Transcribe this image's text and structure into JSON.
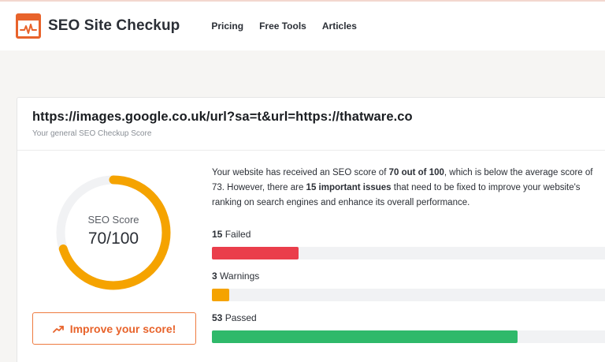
{
  "header": {
    "brand": "SEO Site Checkup",
    "nav": [
      {
        "label": "Pricing"
      },
      {
        "label": "Free Tools"
      },
      {
        "label": "Articles"
      }
    ],
    "logo_icon": "pulse-monitor-icon",
    "accent_color": "#e8632b"
  },
  "report": {
    "url": "https://images.google.co.uk/url?sa=t&url=https://thatware.co",
    "subtitle": "Your general SEO Checkup Score",
    "gauge": {
      "label": "SEO Score",
      "value_text": "70/100",
      "score": 70,
      "max": 100,
      "color": "#f5a300",
      "track_color": "#f1f2f4"
    },
    "description": {
      "t1": "Your website has received an SEO score of ",
      "b1": "70 out of 100",
      "t2": ", which is below the average score of 73. However, there are ",
      "b2": "15 important issues",
      "t3": " that need to be fixed to improve your website's ranking on search engines and enhance its overall performance."
    },
    "improve_button": {
      "label": "Improve your score!",
      "icon": "trending-up-icon"
    },
    "stats": [
      {
        "count": "15",
        "label": "Failed",
        "value": 15,
        "color": "#ea3e4b"
      },
      {
        "count": "3",
        "label": "Warnings",
        "value": 3,
        "color": "#f5a300"
      },
      {
        "count": "53",
        "label": "Passed",
        "value": 53,
        "color": "#2fb96a"
      }
    ],
    "stats_max": 71
  }
}
